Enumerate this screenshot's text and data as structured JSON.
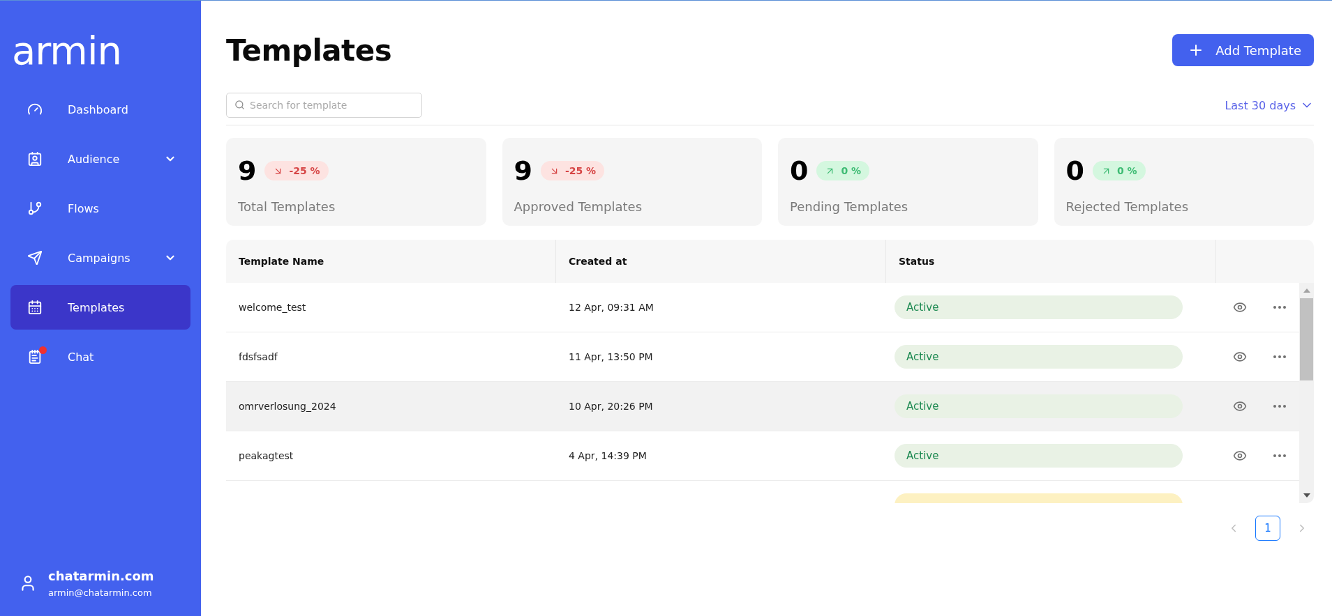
{
  "sidebar": {
    "logo": "armin",
    "items": [
      {
        "label": "Dashboard",
        "has_submenu": false,
        "selected": false,
        "notification": false
      },
      {
        "label": "Audience",
        "has_submenu": true,
        "selected": false,
        "notification": false
      },
      {
        "label": "Flows",
        "has_submenu": false,
        "selected": false,
        "notification": false
      },
      {
        "label": "Campaigns",
        "has_submenu": true,
        "selected": false,
        "notification": false
      },
      {
        "label": "Templates",
        "has_submenu": false,
        "selected": true,
        "notification": false
      },
      {
        "label": "Chat",
        "has_submenu": false,
        "selected": false,
        "notification": true
      }
    ],
    "account": {
      "name": "chatarmin.com",
      "email": "armin@chatarmin.com"
    }
  },
  "header": {
    "title": "Templates",
    "add_button": "Add Template"
  },
  "search": {
    "placeholder": "Search for template"
  },
  "period": "Last 30 days",
  "stats": [
    {
      "value": "9",
      "change": "-25 %",
      "kind": "down",
      "label": "Total Templates"
    },
    {
      "value": "9",
      "change": "-25 %",
      "kind": "down",
      "label": "Approved Templates"
    },
    {
      "value": "0",
      "change": "0 %",
      "kind": "up",
      "label": "Pending Templates"
    },
    {
      "value": "0",
      "change": "0 %",
      "kind": "up",
      "label": "Rejected Templates"
    }
  ],
  "table": {
    "columns": [
      "Template Name",
      "Created at",
      "Status"
    ],
    "rows": [
      {
        "name": "welcome_test",
        "created": "12 Apr, 09:31 AM",
        "status": "Active",
        "kind": "active",
        "hovered": false
      },
      {
        "name": "fdsfsadf",
        "created": "11 Apr, 13:50 PM",
        "status": "Active",
        "kind": "active",
        "hovered": false
      },
      {
        "name": "omrverlosung_2024",
        "created": "10 Apr, 20:26 PM",
        "status": "Active",
        "kind": "active",
        "hovered": true
      },
      {
        "name": "peakagtest",
        "created": "4 Apr, 14:39 PM",
        "status": "Active",
        "kind": "active",
        "hovered": false
      },
      {
        "kind": "draft",
        "hovered": false
      }
    ]
  },
  "pagination": {
    "pages": [
      {
        "label": "1",
        "selected": true
      }
    ]
  }
}
